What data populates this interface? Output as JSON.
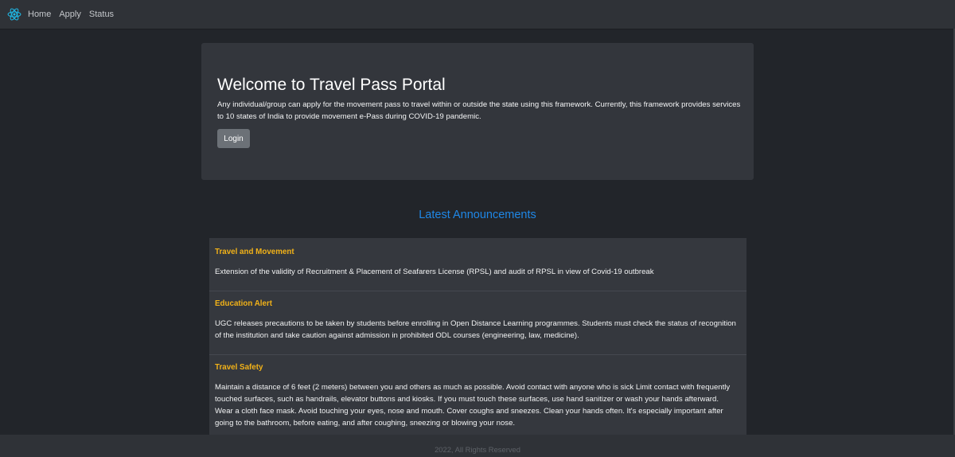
{
  "navbar": {
    "brand_icon": "react-atom-icon",
    "brand_color": "#1fb8e6",
    "links": [
      "Home",
      "Apply",
      "Status"
    ]
  },
  "hero": {
    "title": "Welcome to Travel Pass Portal",
    "description": "Any individual/group can apply for the movement pass to travel within or outside the state using this framework. Currently, this framework provides services to 10 states of India to provide movement e-Pass during COVID-19 pandemic.",
    "login_label": "Login"
  },
  "announcements": {
    "heading": "Latest Announcements",
    "items": [
      {
        "title": "Travel and Movement",
        "text": "Extension of the validity of Recruitment & Placement of Seafarers License (RPSL) and audit of RPSL in view of Covid-19 outbreak"
      },
      {
        "title": "Education Alert",
        "text": "UGC releases precautions to be taken by students before enrolling in Open Distance Learning programmes. Students must check the status of recognition of the institution and take caution against admission in prohibited ODL courses (engineering, law, medicine)."
      },
      {
        "title": "Travel Safety",
        "text": "Maintain a distance of 6 feet (2 meters) between you and others as much as possible. Avoid contact with anyone who is sick Limit contact with frequently touched surfaces, such as handrails, elevator buttons and kiosks. If you must touch these surfaces, use hand sanitizer or wash your hands afterward. Wear a cloth face mask. Avoid touching your eyes, nose and mouth. Cover coughs and sneezes. Clean your hands often. It's especially important after going to the bathroom, before eating, and after coughing, sneezing or blowing your nose."
      }
    ]
  },
  "footer": {
    "text": "2022, All Rights Reserved"
  },
  "colors": {
    "accent": "#1f87e6",
    "announcement_title": "#f2b218",
    "background": "#22252a",
    "panel": "#33363c"
  }
}
